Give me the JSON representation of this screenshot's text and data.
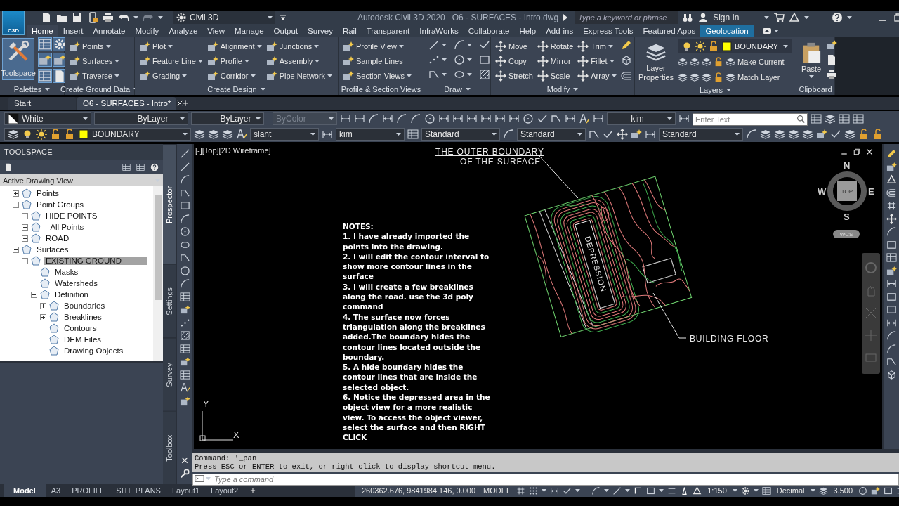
{
  "title_bar": {
    "app_button": "C3D",
    "workspace": "Civil 3D",
    "app_title": "Autodesk Civil 3D 2020",
    "file_title": "O6 - SURFACES - Intro.dwg",
    "search": {
      "placeholder": "Type a keyword or phrase"
    },
    "sign_in": "Sign In"
  },
  "ribbon": {
    "tabs": [
      {
        "label": "Home",
        "selected": true,
        "contextual": false
      },
      {
        "label": "Insert",
        "selected": false,
        "contextual": false
      },
      {
        "label": "Annotate",
        "selected": false,
        "contextual": false
      },
      {
        "label": "Modify",
        "selected": false,
        "contextual": false
      },
      {
        "label": "Analyze",
        "selected": false,
        "contextual": false
      },
      {
        "label": "View",
        "selected": false,
        "contextual": false
      },
      {
        "label": "Manage",
        "selected": false,
        "contextual": false
      },
      {
        "label": "Output",
        "selected": false,
        "contextual": false
      },
      {
        "label": "Survey",
        "selected": false,
        "contextual": false
      },
      {
        "label": "Rail",
        "selected": false,
        "contextual": false
      },
      {
        "label": "Transparent",
        "selected": false,
        "contextual": false
      },
      {
        "label": "InfraWorks",
        "selected": false,
        "contextual": false
      },
      {
        "label": "Collaborate",
        "selected": false,
        "contextual": false
      },
      {
        "label": "Help",
        "selected": false,
        "contextual": false
      },
      {
        "label": "Add-ins",
        "selected": false,
        "contextual": false
      },
      {
        "label": "Express Tools",
        "selected": false,
        "contextual": false
      },
      {
        "label": "Featured Apps",
        "selected": false,
        "contextual": false
      },
      {
        "label": "Geolocation",
        "selected": false,
        "contextual": true
      }
    ],
    "panels": [
      {
        "title": "Palettes",
        "title_dropdown": true,
        "kind": "palettes",
        "big_button": "Toolspace"
      },
      {
        "title": "Create Ground Data",
        "title_dropdown": true,
        "kind": "columns",
        "columns": [
          [
            {
              "label": "Points",
              "dropdown": true
            },
            {
              "label": "Surfaces",
              "dropdown": true
            },
            {
              "label": "Traverse",
              "dropdown": true
            }
          ]
        ]
      },
      {
        "title": "Create Design",
        "title_dropdown": true,
        "kind": "columns",
        "columns": [
          [
            {
              "label": "Plot",
              "dropdown": true
            },
            {
              "label": "Feature Line",
              "dropdown": true
            },
            {
              "label": "Grading",
              "dropdown": true
            }
          ],
          [
            {
              "label": "Alignment",
              "dropdown": true
            },
            {
              "label": "Profile",
              "dropdown": true
            },
            {
              "label": "Corridor",
              "dropdown": true
            }
          ],
          [
            {
              "label": "Junctions",
              "dropdown": true
            },
            {
              "label": "Assembly",
              "dropdown": true
            },
            {
              "label": "Pipe Network",
              "dropdown": true
            }
          ]
        ]
      },
      {
        "title": "Profile & Section Views",
        "title_dropdown": false,
        "kind": "columns",
        "columns": [
          [
            {
              "label": "Profile View",
              "dropdown": true
            },
            {
              "label": "Sample Lines",
              "dropdown": false
            },
            {
              "label": "Section Views",
              "dropdown": true
            }
          ]
        ]
      },
      {
        "title": "Draw",
        "title_dropdown": true,
        "kind": "icons"
      },
      {
        "title": "Modify",
        "title_dropdown": true,
        "kind": "modify",
        "columns": [
          [
            {
              "label": "Move",
              "dropdown": false
            },
            {
              "label": "Copy",
              "dropdown": false
            },
            {
              "label": "Stretch",
              "dropdown": false
            }
          ],
          [
            {
              "label": "Rotate",
              "dropdown": false
            },
            {
              "label": "Mirror",
              "dropdown": false
            },
            {
              "label": "Scale",
              "dropdown": false
            }
          ],
          [
            {
              "label": "Trim",
              "dropdown": true
            },
            {
              "label": "Fillet",
              "dropdown": true
            },
            {
              "label": "Array",
              "dropdown": true
            }
          ]
        ]
      },
      {
        "title": "Layers",
        "title_dropdown": true,
        "kind": "layers",
        "big_button": "Layer Properties",
        "layer": "BOUNDARY",
        "actions": [
          "Make Current",
          "Match Layer"
        ]
      },
      {
        "title": "Clipboard",
        "title_dropdown": false,
        "kind": "clipboard",
        "big_button": "Paste"
      }
    ]
  },
  "document_tabs": [
    {
      "label": "Start",
      "selected": false
    },
    {
      "label": "O6 - SURFACES - Intro*",
      "selected": true
    }
  ],
  "properties_toolbar": {
    "current_color": "White",
    "linetype": "ByLayer",
    "lineweight": "ByLayer",
    "plot_style": {
      "value": "ByColor",
      "disabled": true
    },
    "dim_style": "kim",
    "search": {
      "placeholder": "Enter Text"
    }
  },
  "layers_toolbar": {
    "layer": "BOUNDARY",
    "text_style": "slant",
    "dim_style": "kim",
    "table_style": "Standard",
    "multileader_style": "Standard",
    "annotation_style": "Standard"
  },
  "toolspace": {
    "title": "TOOLSPACE",
    "view": "Active Drawing View",
    "tree": [
      {
        "label": "Points",
        "expanded": false,
        "selected": false
      },
      {
        "label": "Point Groups",
        "expanded": true,
        "selected": false,
        "children": [
          {
            "label": "HIDE POINTS",
            "expanded": false,
            "selected": false
          },
          {
            "label": "_All Points",
            "expanded": false,
            "selected": false
          },
          {
            "label": "ROAD",
            "expanded": false,
            "selected": false
          }
        ]
      },
      {
        "label": "Surfaces",
        "expanded": true,
        "selected": false,
        "children": [
          {
            "label": "EXISTING GROUND",
            "expanded": true,
            "selected": true,
            "children": [
              {
                "label": "Masks",
                "selected": false
              },
              {
                "label": "Watersheds",
                "selected": false
              },
              {
                "label": "Definition",
                "expanded": true,
                "selected": false,
                "children": [
                  {
                    "label": "Boundaries",
                    "expanded": false,
                    "selected": false
                  },
                  {
                    "label": "Breaklines",
                    "expanded": false,
                    "selected": false
                  },
                  {
                    "label": "Contours",
                    "selected": false
                  },
                  {
                    "label": "DEM Files",
                    "selected": false
                  },
                  {
                    "label": "Drawing Objects",
                    "selected": false
                  }
                ]
              }
            ]
          }
        ]
      }
    ],
    "side_tabs": [
      {
        "label": "Prospector",
        "selected": true
      },
      {
        "label": "Settings",
        "selected": false
      },
      {
        "label": "Survey",
        "selected": false
      },
      {
        "label": "Toolbox",
        "selected": false
      }
    ]
  },
  "viewport": {
    "label": "[-][Top][2D Wireframe]",
    "notes": [
      "NOTES:",
      "1. I have already imported the points into the drawing.",
      "2. I will edit the contour interval to show more contour lines in the surface",
      "3. I will create a few breaklines along the road. use the 3d poly command",
      "4. The surface now forces triangulation along the breaklines added.The boundary hides the contour lines located outside the boundary.",
      "5. A hide boundary hides the contour lines that are inside the selected object.",
      "6. Notice the depressed area in the object view for a more realistic view. To access the object viewer, select the surface and then RIGHT CLICK"
    ],
    "callout_lines": [
      "THE OUTER BOUNDARY",
      "OF THE SURFACE"
    ],
    "depression_label": "DEPRESSION",
    "building_label": "BUILDING FLOOR",
    "viewcube": {
      "north": "N",
      "south": "S",
      "east": "E",
      "west": "W",
      "face": "TOP",
      "ucs": "WCS"
    },
    "ucs_icon": {
      "y": "Y",
      "x": "X"
    }
  },
  "command_line": {
    "history": [
      "Command: '_pan",
      "Press ESC or ENTER to exit, or right-click to display shortcut menu."
    ],
    "placeholder": "Type a command"
  },
  "layout_tabs": [
    {
      "label": "Model",
      "selected": true
    },
    {
      "label": "A3",
      "selected": false
    },
    {
      "label": "PROFILE",
      "selected": false
    },
    {
      "label": "SITE PLANS",
      "selected": false
    },
    {
      "label": "Layout1",
      "selected": false
    },
    {
      "label": "Layout2",
      "selected": false
    }
  ],
  "status_bar": {
    "coordinates": "260362.676, 9841984.146, 0.000",
    "space": "MODEL",
    "scale": "1:150",
    "units": "Decimal",
    "value": "3.500"
  }
}
